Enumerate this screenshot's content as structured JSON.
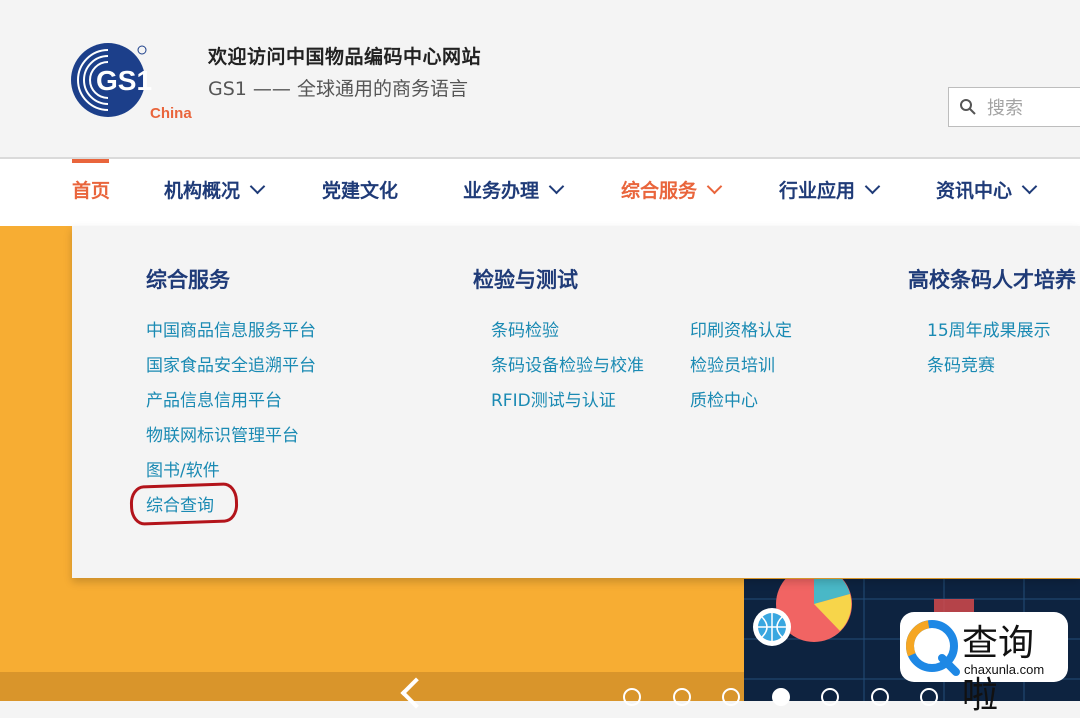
{
  "header": {
    "logo": {
      "mark": "GS1",
      "sub": "China"
    },
    "title": "欢迎访问中国物品编码中心网站",
    "slogan": "GS1 —— 全球通用的商务语言",
    "search": {
      "placeholder": "搜索"
    }
  },
  "nav": {
    "items": [
      {
        "label": "首页"
      },
      {
        "label": "机构概况"
      },
      {
        "label": "党建文化"
      },
      {
        "label": "业务办理"
      },
      {
        "label": "综合服务"
      },
      {
        "label": "行业应用"
      },
      {
        "label": "资讯中心"
      }
    ]
  },
  "dropdown": {
    "columns": [
      {
        "heading": "综合服务",
        "links": [
          "中国商品信息服务平台",
          "国家食品安全追溯平台",
          "产品信息信用平台",
          "物联网标识管理平台",
          "图书/软件",
          "综合查询"
        ]
      },
      {
        "heading": "检验与测试",
        "links": [
          "条码检验",
          "条码设备检验与校准",
          "RFID测试与认证"
        ],
        "links_b": [
          "印刷资格认定",
          "检验员培训",
          "质检中心"
        ]
      },
      {
        "heading": "高校条码人才培养",
        "links": [
          "15周年成果展示",
          "条码竞赛"
        ]
      }
    ]
  },
  "watermark": {
    "text": "查询啦",
    "sub": "chaxunla.com"
  },
  "colors": {
    "accent": "#e9653c",
    "nav_text": "#1f3b78",
    "link": "#1a8ab3",
    "banner": "#f7ad33",
    "highlight": "#b3141b"
  }
}
